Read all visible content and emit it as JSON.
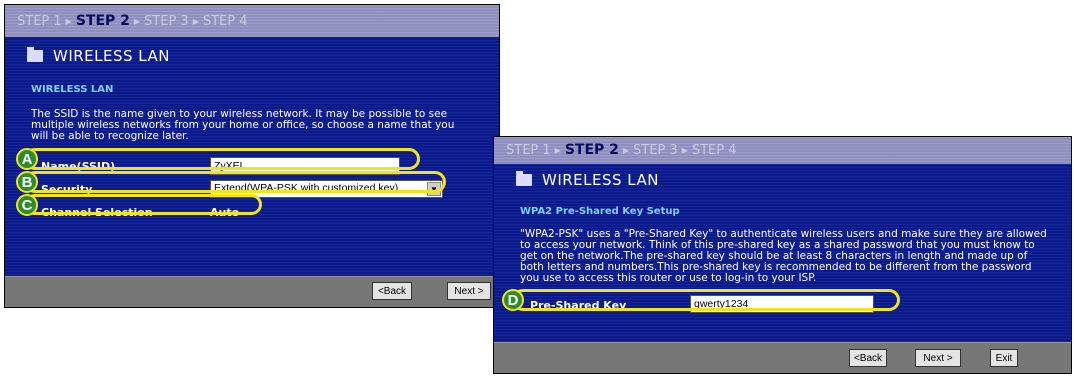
{
  "left_window": {
    "steps": [
      "STEP 1",
      "STEP 2",
      "STEP 3",
      "STEP 4"
    ],
    "title": "WIRELESS LAN",
    "section_title": "WIRELESS LAN",
    "description": "The SSID is the name given to your wireless network. It may be possible to see multiple wireless networks from your home or office, so choose a name that you will be able to recognize later.",
    "ssid_label": "Name(SSID)",
    "ssid_value": "ZyXEL",
    "security_label": "Security",
    "security_value": "Extend(WPA-PSK with customized key)",
    "channel_label": "Channel Selection",
    "channel_value": "Auto",
    "back_label": "<Back",
    "next_label": "Next >"
  },
  "right_window": {
    "steps": [
      "STEP 1",
      "STEP 2",
      "STEP 3",
      "STEP 4"
    ],
    "title": "WIRELESS LAN",
    "section_title": "WPA2 Pre-Shared Key Setup",
    "description": "\"WPA2-PSK\" uses a \"Pre-Shared Key\" to authenticate wireless users and make sure they are allowed to access your network. Think of this pre-shared key as a shared password that you must know to get on the network.The pre-shared key should be at least 8 characters in length and made up of both letters and numbers.This pre-shared key is recommended to be different from the password you use to access this router or use to log-in to your ISP.",
    "psk_label": "Pre-Shared Key",
    "psk_value": "qwerty1234",
    "back_label": "<Back",
    "next_label": "Next >",
    "exit_label": "Exit"
  },
  "callouts": [
    "A",
    "B",
    "C",
    "D"
  ],
  "colors": {
    "highlight": "#f2e41a",
    "callout": "#2f8b2f",
    "panel": "#0a1a8c"
  }
}
